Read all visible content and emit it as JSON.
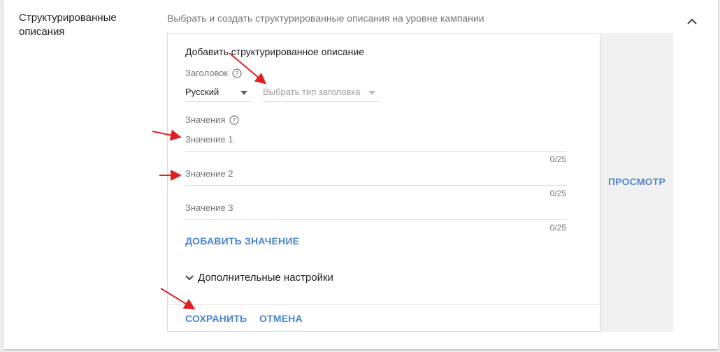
{
  "section": {
    "title": "Структурированные описания",
    "description": "Выбрать и создать структурированные описания на уровне кампании",
    "collapse_icon": "chevron-up-icon"
  },
  "form": {
    "heading": "Добавить структурированное описание",
    "header_label": "Заголовок",
    "language_select": {
      "value": "Русский"
    },
    "header_type_select": {
      "placeholder": "Выбрать тип заголовка"
    },
    "values_label": "Значения",
    "values": [
      {
        "placeholder": "Значение 1",
        "counter": "0/25"
      },
      {
        "placeholder": "Значение 2",
        "counter": "0/25"
      },
      {
        "placeholder": "Значение 3",
        "counter": "0/25"
      }
    ],
    "add_value_label": "ДОБАВИТЬ ЗНАЧЕНИЕ",
    "advanced_label": "Дополнительные настройки",
    "save_label": "СОХРАНИТЬ",
    "cancel_label": "ОТМЕНА"
  },
  "preview": {
    "label": "ПРОСМОТР"
  },
  "colors": {
    "accent": "#4a85d0",
    "annotation_arrow": "#e02020",
    "text_primary": "#212121",
    "text_secondary": "#757575"
  }
}
